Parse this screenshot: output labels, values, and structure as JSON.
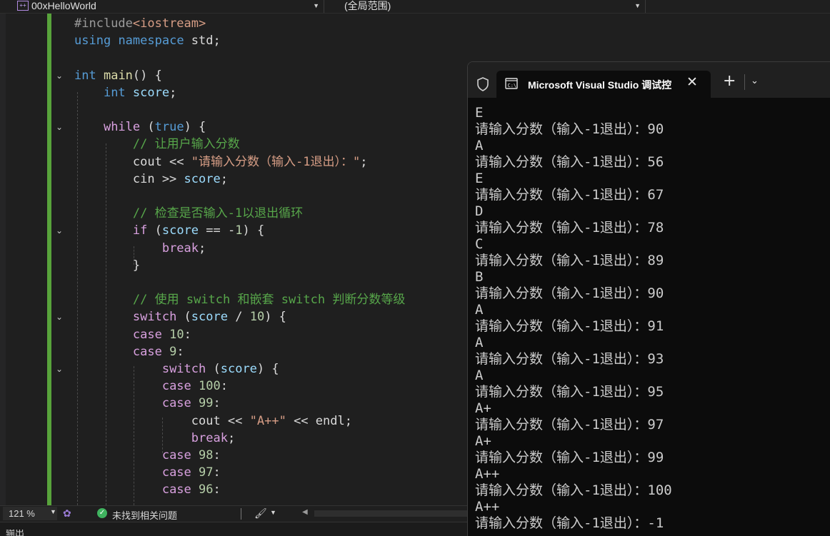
{
  "navbar": {
    "project": "00xHelloWorld",
    "scope": "(全局范围)"
  },
  "code_lines": [
    {
      "row": 0,
      "tokens": [
        {
          "c": "pp",
          "t": "#include"
        },
        {
          "c": "str",
          "t": "<iostream>"
        }
      ]
    },
    {
      "row": 1,
      "tokens": [
        {
          "c": "kw",
          "t": "using"
        },
        {
          "c": "",
          "t": " "
        },
        {
          "c": "kw",
          "t": "namespace"
        },
        {
          "c": "",
          "t": " std;"
        }
      ]
    },
    {
      "row": 3,
      "tokens": [
        {
          "c": "kw",
          "t": "int"
        },
        {
          "c": "",
          "t": " "
        },
        {
          "c": "fn",
          "t": "main"
        },
        {
          "c": "",
          "t": "() {"
        }
      ]
    },
    {
      "row": 4,
      "tokens": [
        {
          "c": "",
          "t": "    "
        },
        {
          "c": "kw",
          "t": "int"
        },
        {
          "c": "",
          "t": " "
        },
        {
          "c": "var",
          "t": "score"
        },
        {
          "c": "",
          "t": ";"
        }
      ]
    },
    {
      "row": 6,
      "tokens": [
        {
          "c": "",
          "t": "    "
        },
        {
          "c": "ctl",
          "t": "while"
        },
        {
          "c": "",
          "t": " ("
        },
        {
          "c": "kw",
          "t": "true"
        },
        {
          "c": "",
          "t": ") {"
        }
      ]
    },
    {
      "row": 7,
      "tokens": [
        {
          "c": "",
          "t": "        "
        },
        {
          "c": "cmt",
          "t": "// 让用户输入分数"
        }
      ]
    },
    {
      "row": 8,
      "tokens": [
        {
          "c": "",
          "t": "        cout << "
        },
        {
          "c": "str",
          "t": "\"请输入分数（输入-1退出）：\""
        },
        {
          "c": "",
          "t": ";"
        }
      ]
    },
    {
      "row": 9,
      "tokens": [
        {
          "c": "",
          "t": "        cin >> "
        },
        {
          "c": "var",
          "t": "score"
        },
        {
          "c": "",
          "t": ";"
        }
      ]
    },
    {
      "row": 11,
      "tokens": [
        {
          "c": "",
          "t": "        "
        },
        {
          "c": "cmt",
          "t": "// 检查是否输入-1以退出循环"
        }
      ]
    },
    {
      "row": 12,
      "tokens": [
        {
          "c": "",
          "t": "        "
        },
        {
          "c": "ctl",
          "t": "if"
        },
        {
          "c": "",
          "t": " ("
        },
        {
          "c": "var",
          "t": "score"
        },
        {
          "c": "",
          "t": " == -"
        },
        {
          "c": "num",
          "t": "1"
        },
        {
          "c": "",
          "t": ") {"
        }
      ]
    },
    {
      "row": 13,
      "tokens": [
        {
          "c": "",
          "t": "            "
        },
        {
          "c": "ctl",
          "t": "break"
        },
        {
          "c": "",
          "t": ";"
        }
      ]
    },
    {
      "row": 14,
      "tokens": [
        {
          "c": "",
          "t": "        }"
        }
      ]
    },
    {
      "row": 16,
      "tokens": [
        {
          "c": "",
          "t": "        "
        },
        {
          "c": "cmt",
          "t": "// 使用 switch 和嵌套 switch 判断分数等级"
        }
      ]
    },
    {
      "row": 17,
      "tokens": [
        {
          "c": "",
          "t": "        "
        },
        {
          "c": "ctl",
          "t": "switch"
        },
        {
          "c": "",
          "t": " ("
        },
        {
          "c": "var",
          "t": "score"
        },
        {
          "c": "",
          "t": " / "
        },
        {
          "c": "num",
          "t": "10"
        },
        {
          "c": "",
          "t": ") {"
        }
      ]
    },
    {
      "row": 18,
      "tokens": [
        {
          "c": "",
          "t": "        "
        },
        {
          "c": "ctl",
          "t": "case"
        },
        {
          "c": "",
          "t": " "
        },
        {
          "c": "num",
          "t": "10"
        },
        {
          "c": "",
          "t": ":"
        }
      ]
    },
    {
      "row": 19,
      "tokens": [
        {
          "c": "",
          "t": "        "
        },
        {
          "c": "ctl",
          "t": "case"
        },
        {
          "c": "",
          "t": " "
        },
        {
          "c": "num",
          "t": "9"
        },
        {
          "c": "",
          "t": ":"
        }
      ]
    },
    {
      "row": 20,
      "tokens": [
        {
          "c": "",
          "t": "            "
        },
        {
          "c": "ctl",
          "t": "switch"
        },
        {
          "c": "",
          "t": " ("
        },
        {
          "c": "var",
          "t": "score"
        },
        {
          "c": "",
          "t": ") {"
        }
      ]
    },
    {
      "row": 21,
      "tokens": [
        {
          "c": "",
          "t": "            "
        },
        {
          "c": "ctl",
          "t": "case"
        },
        {
          "c": "",
          "t": " "
        },
        {
          "c": "num",
          "t": "100"
        },
        {
          "c": "",
          "t": ":"
        }
      ]
    },
    {
      "row": 22,
      "tokens": [
        {
          "c": "",
          "t": "            "
        },
        {
          "c": "ctl",
          "t": "case"
        },
        {
          "c": "",
          "t": " "
        },
        {
          "c": "num",
          "t": "99"
        },
        {
          "c": "",
          "t": ":"
        }
      ]
    },
    {
      "row": 23,
      "tokens": [
        {
          "c": "",
          "t": "                cout << "
        },
        {
          "c": "str",
          "t": "\"A++\""
        },
        {
          "c": "",
          "t": " << endl;"
        }
      ]
    },
    {
      "row": 24,
      "tokens": [
        {
          "c": "",
          "t": "                "
        },
        {
          "c": "ctl",
          "t": "break"
        },
        {
          "c": "",
          "t": ";"
        }
      ]
    },
    {
      "row": 25,
      "tokens": [
        {
          "c": "",
          "t": "            "
        },
        {
          "c": "ctl",
          "t": "case"
        },
        {
          "c": "",
          "t": " "
        },
        {
          "c": "num",
          "t": "98"
        },
        {
          "c": "",
          "t": ":"
        }
      ]
    },
    {
      "row": 26,
      "tokens": [
        {
          "c": "",
          "t": "            "
        },
        {
          "c": "ctl",
          "t": "case"
        },
        {
          "c": "",
          "t": " "
        },
        {
          "c": "num",
          "t": "97"
        },
        {
          "c": "",
          "t": ":"
        }
      ]
    },
    {
      "row": 27,
      "tokens": [
        {
          "c": "",
          "t": "            "
        },
        {
          "c": "ctl",
          "t": "case"
        },
        {
          "c": "",
          "t": " "
        },
        {
          "c": "num",
          "t": "96"
        },
        {
          "c": "",
          "t": ":"
        }
      ]
    }
  ],
  "fold_rows": [
    3,
    6,
    12,
    17,
    20
  ],
  "statusbar": {
    "zoom": "121 %",
    "issues": "未找到相关问题"
  },
  "output_panel": {
    "label": "输出"
  },
  "terminal": {
    "tab_title": "Microsoft Visual Studio 调试控",
    "lines": [
      "E",
      "请输入分数（输入-1退出）：90",
      "A",
      "请输入分数（输入-1退出）：56",
      "E",
      "请输入分数（输入-1退出）：67",
      "D",
      "请输入分数（输入-1退出）：78",
      "C",
      "请输入分数（输入-1退出）：89",
      "B",
      "请输入分数（输入-1退出）：90",
      "A",
      "请输入分数（输入-1退出）：91",
      "A",
      "请输入分数（输入-1退出）：93",
      "A",
      "请输入分数（输入-1退出）：95",
      "A+",
      "请输入分数（输入-1退出）：97",
      "A+",
      "请输入分数（输入-1退出）：99",
      "A++",
      "请输入分数（输入-1退出）：100",
      "A++",
      "请输入分数（输入-1退出）：-1"
    ]
  }
}
